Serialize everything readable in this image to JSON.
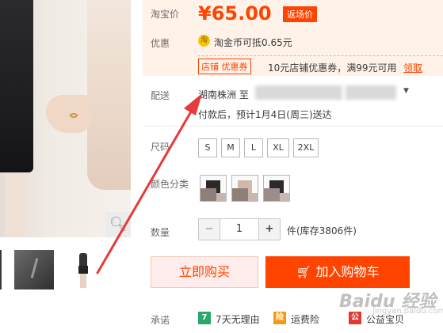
{
  "price": {
    "label": "淘宝价",
    "value": "¥65.00",
    "tag": "返场价"
  },
  "promo": {
    "label": "优惠",
    "coin_icon": "淘",
    "coin_text": "淘金币可抵0.65元",
    "shop_tag": "店铺 优惠券",
    "coupon_text": "10元店铺优惠券，满99元可用",
    "claim_label": "领取"
  },
  "delivery": {
    "label": "配送",
    "from": "湖南株洲 至",
    "note": "付款后，预计1月4日(周三)送达"
  },
  "size": {
    "label": "尺码",
    "options": [
      "S",
      "M",
      "L",
      "XL",
      "2XL"
    ]
  },
  "color": {
    "label": "颜色分类"
  },
  "quantity": {
    "label": "数量",
    "minus": "−",
    "value": "1",
    "plus": "+",
    "stock": "件(库存3806件)"
  },
  "actions": {
    "buy": "立即购买",
    "cart": "加入购物车"
  },
  "promise": {
    "label": "承诺",
    "items": [
      {
        "icon": "7",
        "text": "7天无理由",
        "color": "#2aa86b"
      },
      {
        "icon": "险",
        "text": "运费险",
        "color": "#f29a16"
      },
      {
        "icon": "公",
        "text": "公益宝贝",
        "color": "#e0392f"
      }
    ]
  },
  "gallery": {
    "zoom_icon": "magnifier-icon"
  },
  "watermark": {
    "main": "Baidu 经验",
    "sub": "jingyan.baidu.com"
  },
  "colors": {
    "accent": "#ff4400",
    "price_bg": "#fff2e8",
    "arrow": "#e8393b"
  }
}
